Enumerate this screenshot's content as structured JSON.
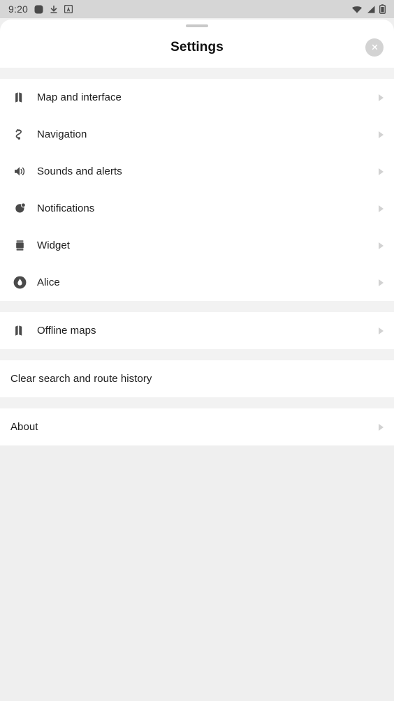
{
  "status_bar": {
    "time": "9:20",
    "left_icons": [
      "app-square-icon",
      "download-icon",
      "boxed-a-icon"
    ],
    "right_icons": [
      "wifi-icon",
      "cellular-signal-icon",
      "battery-icon"
    ]
  },
  "sheet": {
    "title": "Settings",
    "close_label": "×",
    "grabber": "drag-handle"
  },
  "sections": [
    {
      "id": "main",
      "items": [
        {
          "label": "Map and interface",
          "icon": "map-icon",
          "chevron": true
        },
        {
          "label": "Navigation",
          "icon": "route-icon",
          "chevron": true
        },
        {
          "label": "Sounds and alerts",
          "icon": "speaker-icon",
          "chevron": true
        },
        {
          "label": "Notifications",
          "icon": "notification-icon",
          "chevron": true
        },
        {
          "label": "Widget",
          "icon": "widget-icon",
          "chevron": true
        },
        {
          "label": "Alice",
          "icon": "alice-icon",
          "chevron": true
        }
      ]
    },
    {
      "id": "offline",
      "items": [
        {
          "label": "Offline maps",
          "icon": "map-icon",
          "chevron": true
        }
      ]
    },
    {
      "id": "history",
      "items": [
        {
          "label": "Clear search and route history",
          "icon": null,
          "chevron": false
        }
      ]
    },
    {
      "id": "about",
      "items": [
        {
          "label": "About",
          "icon": null,
          "chevron": true
        }
      ]
    }
  ],
  "colors": {
    "sheet_background": "#ffffff",
    "page_background": "#efefef",
    "section_gap": "#f2f2f2",
    "status_bar": "#d6d6d6",
    "text_primary": "#1c1c1c",
    "icon": "#4a4a4a",
    "chevron": "#d2d2d2",
    "close_circle": "#d3d3d3"
  }
}
